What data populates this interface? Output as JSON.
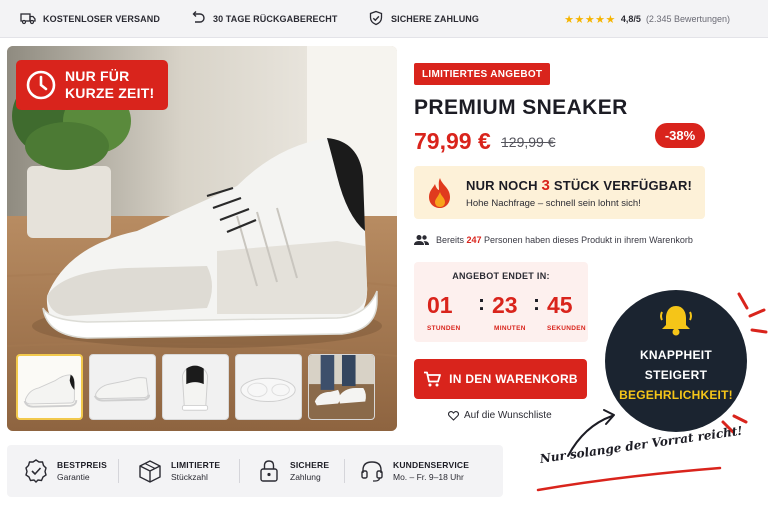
{
  "topbar": {
    "shipping": "KOSTENLOSER VERSAND",
    "returns": "30 TAGE RÜCKGABERECHT",
    "payment": "SICHERE ZAHLUNG",
    "stars": "★★★★★",
    "score": "4,8/5",
    "reviews": "(2.345 Bewertungen)"
  },
  "gallery": {
    "badge_line1": "NUR FÜR",
    "badge_line2": "KURZE ZEIT!",
    "thumb_count": 5,
    "active_thumb": 1
  },
  "product": {
    "badge": "LIMITIERTES ANGEBOT",
    "title": "PREMIUM SNEAKER",
    "price": "79,99 €",
    "old_price": "129,99 €",
    "discount": "-38%",
    "stock_prefix": "NUR NOCH ",
    "stock_count": "3",
    "stock_suffix": " STÜCK VERFÜGBAR!",
    "stock_sub": "Hohe Nachfrage – schnell sein lohnt sich!",
    "social_prefix": "Bereits ",
    "social_count": "247",
    "social_suffix": " Personen haben dieses Produkt in ihrem Warenkorb"
  },
  "timer": {
    "label": "ANGEBOT ENDET IN:",
    "hours": "01",
    "minutes": "23",
    "seconds": "45",
    "sep": ":",
    "hours_label": "STUNDEN",
    "minutes_label": "MINUTEN",
    "seconds_label": "SEKUNDEN"
  },
  "actions": {
    "cart": "IN DEN WARENKORB",
    "wishlist": "Auf die Wunschliste"
  },
  "bubble": {
    "line1": "KNAPPHEIT",
    "line2": "STEIGERT",
    "line3": "BEGEHRLICHKEIT!",
    "note": "Nur solange der Vorrat reicht!"
  },
  "trust": [
    {
      "title": "BESTPREIS",
      "sub": "Garantie",
      "icon": "badge-check-icon"
    },
    {
      "title": "LIMITIERTE",
      "sub": "Stückzahl",
      "icon": "box-icon"
    },
    {
      "title": "SICHERE",
      "sub": "Zahlung",
      "icon": "lock-icon"
    },
    {
      "title": "KUNDENSERVICE",
      "sub": "Mo. – Fr. 9–18 Uhr",
      "icon": "headset-icon"
    }
  ],
  "colors": {
    "accent": "#d9241c",
    "dark": "#1b2430",
    "highlight": "#f5c518",
    "stock_bg": "#fdf1d8"
  }
}
